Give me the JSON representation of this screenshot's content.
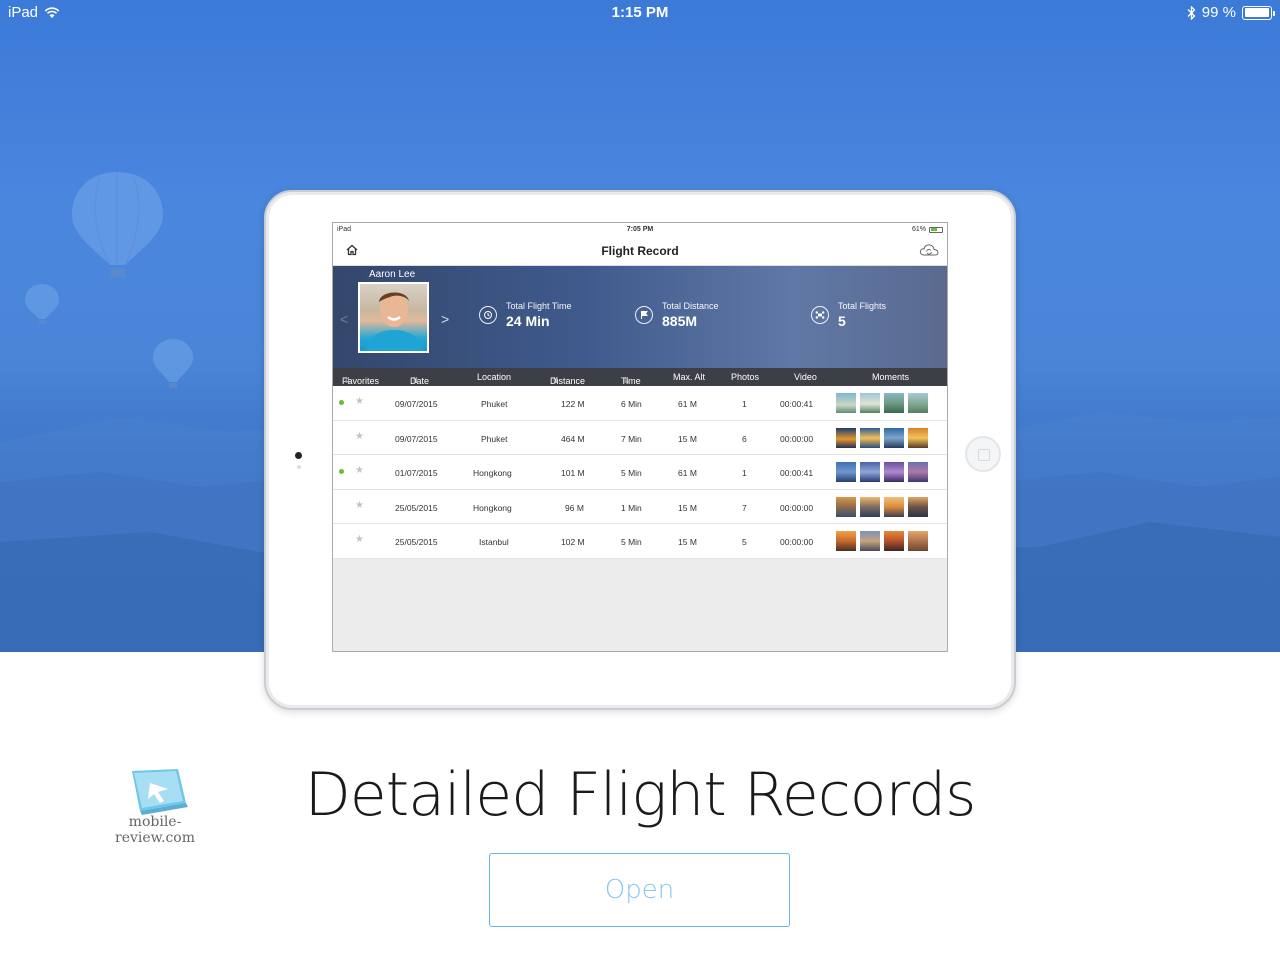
{
  "os_status": {
    "device": "iPad",
    "time": "1:15 PM",
    "battery": "99 %",
    "wifi_icon": "wifi-icon",
    "bluetooth_icon": "bluetooth-icon",
    "battery_level": 0.99
  },
  "inner_status": {
    "device": "iPad",
    "time": "7:05 PM",
    "battery": "61%",
    "battery_level": 0.61
  },
  "nav": {
    "title": "Flight Record",
    "left_icon": "home-icon",
    "right_icon": "cloud-sync-icon"
  },
  "profile": {
    "name": "Aaron Lee",
    "stats": [
      {
        "icon": "clock-icon",
        "label": "Total Flight Time",
        "value": "24 Min"
      },
      {
        "icon": "flag-icon",
        "label": "Total Distance",
        "value": "885M"
      },
      {
        "icon": "drone-icon",
        "label": "Total Flights",
        "value": "5"
      }
    ]
  },
  "table": {
    "headers": {
      "favorites": "Favorites",
      "date": "Date",
      "location": "Location",
      "distance": "Distance",
      "time": "Time",
      "max_alt": "Max. Alt",
      "photos": "Photos",
      "video": "Video",
      "moments": "Moments"
    },
    "rows": [
      {
        "fav_dot": true,
        "date": "09/07/2015",
        "location": "Phuket",
        "distance": "122 M",
        "time": "6 Min",
        "alt": "61 M",
        "photos": "1",
        "video": "00:00:41"
      },
      {
        "fav_dot": false,
        "date": "09/07/2015",
        "location": "Phuket",
        "distance": "464 M",
        "time": "7 Min",
        "alt": "15 M",
        "photos": "6",
        "video": "00:00:00"
      },
      {
        "fav_dot": true,
        "date": "01/07/2015",
        "location": "Hongkong",
        "distance": "101 M",
        "time": "5 Min",
        "alt": "61 M",
        "photos": "1",
        "video": "00:00:41"
      },
      {
        "fav_dot": false,
        "date": "25/05/2015",
        "location": "Hongkong",
        "distance": "96 M",
        "time": "1 Min",
        "alt": "15 M",
        "photos": "7",
        "video": "00:00:00"
      },
      {
        "fav_dot": false,
        "date": "25/05/2015",
        "location": "Istanbul",
        "distance": "102 M",
        "time": "5 Min",
        "alt": "15 M",
        "photos": "5",
        "video": "00:00:00"
      }
    ]
  },
  "headline": "Detailed Flight Records",
  "open_button": "Open",
  "watermark": "mobile-review.com",
  "colors": {
    "accent": "#6ab4e6",
    "sky": "#4a86de",
    "favorite_dot": "#6dbb2e"
  }
}
